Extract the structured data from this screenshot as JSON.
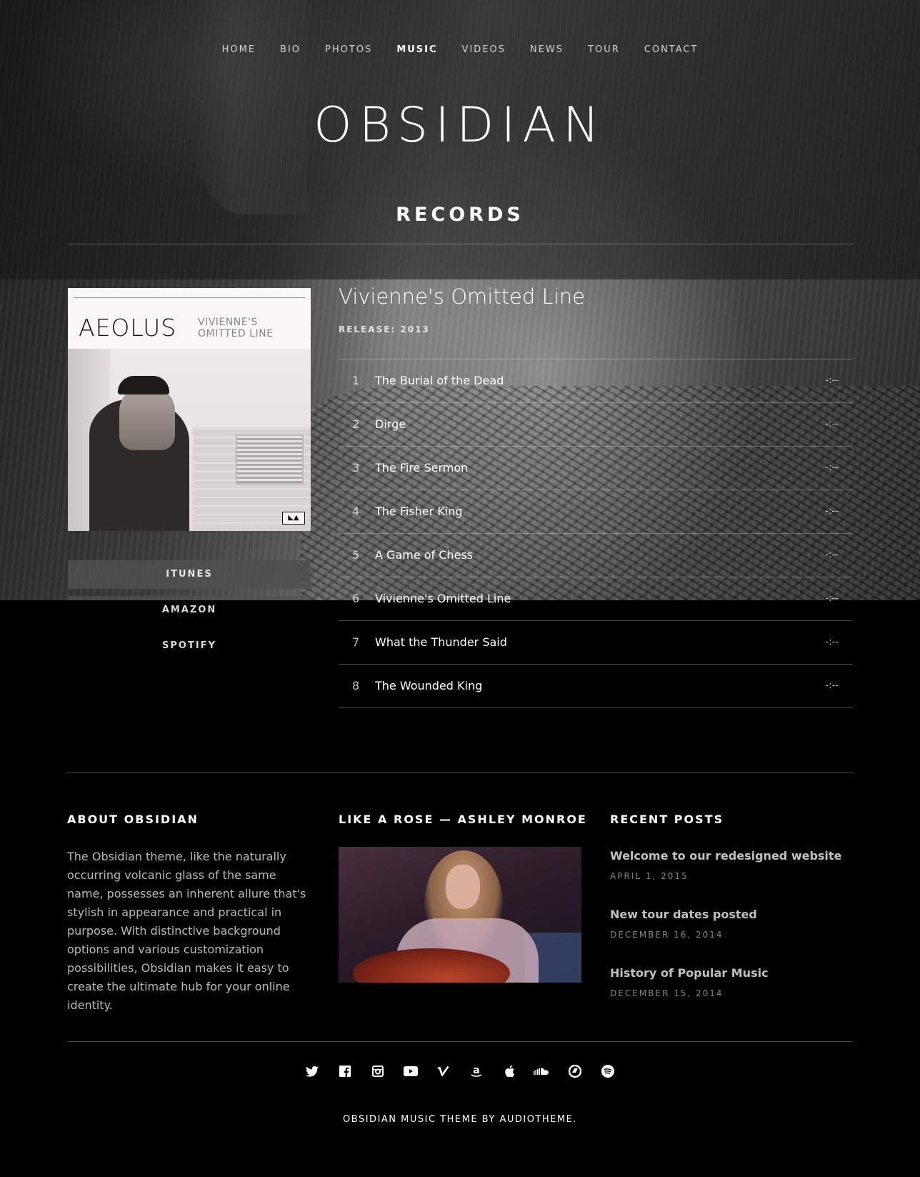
{
  "nav": {
    "items": [
      {
        "label": "HOME"
      },
      {
        "label": "BIO"
      },
      {
        "label": "PHOTOS"
      },
      {
        "label": "MUSIC",
        "active": true
      },
      {
        "label": "VIDEOS"
      },
      {
        "label": "NEWS"
      },
      {
        "label": "TOUR"
      },
      {
        "label": "CONTACT"
      }
    ]
  },
  "site": {
    "logo": "OBSIDIAN"
  },
  "page": {
    "section_title": "RECORDS"
  },
  "album": {
    "cover_title": "AEOLUS",
    "cover_subtitle_line1": "VIVIENNE'S",
    "cover_subtitle_line2": "OMITTED LINE",
    "stores": {
      "itunes": "ITUNES",
      "amazon": "AMAZON",
      "spotify": "SPOTIFY"
    }
  },
  "record": {
    "title": "Vivienne's Omitted Line",
    "release": "RELEASE: 2013",
    "tracks": [
      {
        "num": "1",
        "name": "The Burial of the Dead",
        "time": "-:--"
      },
      {
        "num": "2",
        "name": "Dirge",
        "time": "-:--"
      },
      {
        "num": "3",
        "name": "The Fire Sermon",
        "time": "-:--"
      },
      {
        "num": "4",
        "name": "The Fisher King",
        "time": "-:--"
      },
      {
        "num": "5",
        "name": "A Game of Chess",
        "time": "-:--"
      },
      {
        "num": "6",
        "name": "Vivienne's Omitted Line",
        "time": "-:--"
      },
      {
        "num": "7",
        "name": "What the Thunder Said",
        "time": "-:--"
      },
      {
        "num": "8",
        "name": "The Wounded King",
        "time": "-:--"
      }
    ]
  },
  "widgets": {
    "about": {
      "title": "ABOUT OBSIDIAN",
      "text": "The Obsidian theme, like the naturally occurring volcanic glass of the same name, possesses an inherent allure that's stylish in appearance and practical in purpose. With distinctive background options and various customization possibilities, Obsidian makes it easy to create the ultimate hub for your online identity."
    },
    "video": {
      "title": "LIKE A ROSE — ASHLEY MONROE"
    },
    "recent": {
      "title": "RECENT POSTS",
      "posts": [
        {
          "title": "Welcome to our redesigned website",
          "date": "APRIL 1, 2015"
        },
        {
          "title": "New tour dates posted",
          "date": "DECEMBER 16, 2014"
        },
        {
          "title": "History of Popular Music",
          "date": "DECEMBER 15, 2014"
        }
      ]
    }
  },
  "social": [
    "twitter-icon",
    "facebook-icon",
    "instagram-icon",
    "youtube-icon",
    "vimeo-icon",
    "amazon-icon",
    "apple-icon",
    "soundcloud-icon",
    "bandcamp-icon",
    "spotify-icon"
  ],
  "footer": {
    "credit": "OBSIDIAN MUSIC THEME BY AUDIOTHEME."
  },
  "colors": {
    "background": "#000000",
    "text": "#ffffff",
    "muted": "#bfbfbf",
    "divider": "#474747"
  }
}
